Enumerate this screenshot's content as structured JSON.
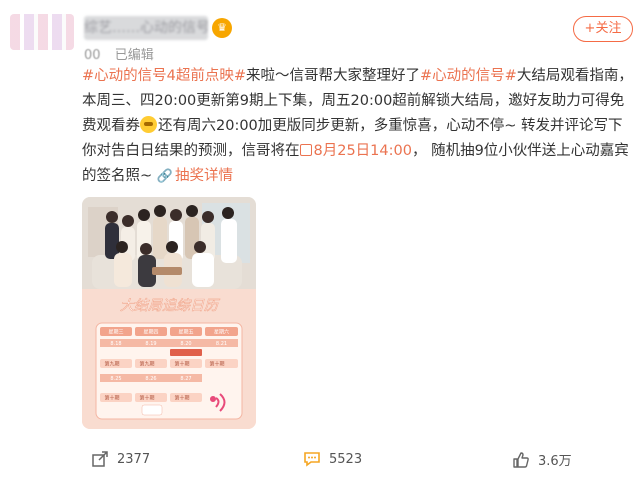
{
  "header": {
    "username": "综艺……心动的信号",
    "time_text": "00",
    "edited_label": "已编辑",
    "follow_label": "+关注"
  },
  "post": {
    "topic1": "#心动的信号4超前点映#",
    "text1": "来啦～信哥帮大家整理好了",
    "topic2": "#心动的信号#",
    "text2": "大结局观看指南，本周三、四20:00更新第9期上下集，周五20:00超前解锁大结局，邀好友助力可得免费观看券",
    "text3": "还有周六20:00加更版同步更新，多重惊喜，心动不停~ 转发并评论写下你对告白日结果的预测，信哥将在",
    "date_link": "8月25日14:00",
    "text4": "， 随机抽9位小伙伴送上心动嘉宾的签名照~",
    "lottery_link": "抽奖详情"
  },
  "poster": {
    "title": "大结局追综日历",
    "weekdays": [
      "星期三",
      "星期四",
      "星期五",
      "星期六"
    ],
    "week1_dates": [
      "8.18",
      "8.19",
      "8.20",
      "8.21"
    ],
    "week2_dates": [
      "8.25",
      "8.26",
      "8.27"
    ],
    "week1_episodes": [
      "第九期",
      "第九期",
      "第十期",
      "第十期"
    ],
    "week2_episodes": [
      "第十期",
      "第十期",
      "第十期"
    ]
  },
  "actions": {
    "share_count": "2377",
    "comment_count": "5523",
    "like_count": "3.6万"
  },
  "icons": {
    "share": "share-icon",
    "comment": "comment-icon",
    "like": "thumbs-up-icon",
    "link": "link-icon",
    "calendar": "calendar-icon"
  },
  "colors": {
    "accent": "#eb7350",
    "follow": "#f56b45",
    "poster_pink": "#f28c8c",
    "comment_orange": "#f5a623"
  }
}
